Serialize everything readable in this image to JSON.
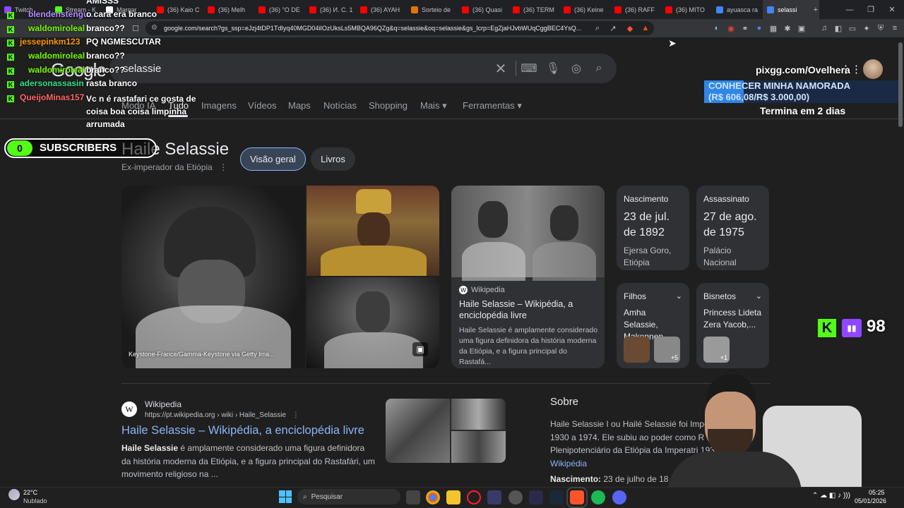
{
  "tabs": [
    {
      "label": "Twitch",
      "color": "#9146ff"
    },
    {
      "label": "Stream - K",
      "color": "#53fc18"
    },
    {
      "label": "Margar",
      "color": "#ffffff"
    },
    {
      "label": "(36) Kaio C",
      "color": "#ff0000"
    },
    {
      "label": "(36) Melh",
      "color": "#ff0000"
    },
    {
      "label": "(36) \"O DE",
      "color": "#ff0000"
    },
    {
      "label": "(36) И. С. 1",
      "color": "#ff0000"
    },
    {
      "label": "(36) AYAH",
      "color": "#ff0000"
    },
    {
      "label": "Sorteio de",
      "color": "#e8710a"
    },
    {
      "label": "(36) Quasi",
      "color": "#ff0000"
    },
    {
      "label": "(36) TERM",
      "color": "#ff0000"
    },
    {
      "label": "(36) Keine",
      "color": "#ff0000"
    },
    {
      "label": "(36) RAFF",
      "color": "#ff0000"
    },
    {
      "label": "(36) MITO",
      "color": "#ff0000"
    },
    {
      "label": "ayuasca ra",
      "color": "#4285f4"
    },
    {
      "label": "selassi",
      "color": "#4285f4",
      "active": true
    }
  ],
  "address": {
    "url": "google.com/search?gs_ssp=eJzj4tDP1TdIyq40MGD04iIOzUksLs5MBQA96QZg&q=selassie&oq=selassie&gs_lcrp=EgZjaHJvbWUqCggBEC4YsQ..."
  },
  "search": {
    "logo": "Google",
    "query": "selassie",
    "tabs": [
      "Modo IA",
      "Tudo",
      "Imagens",
      "Vídeos",
      "Maps",
      "Notícias",
      "Shopping",
      "Mais",
      "Ferramentas"
    ]
  },
  "knowledge_panel": {
    "title": "Haile Selassie",
    "subtitle": "Ex-imperador da Etiópia",
    "chips": [
      "Visão geral",
      "Livros"
    ],
    "image_credit": "Keystone-France/Gamma-Keystone via Getty Ima...",
    "wiki_card": {
      "source": "Wikipedia",
      "title": "Haile Selassie – Wikipédia, a enciclopédia livre",
      "snippet": "Haile Selassie é amplamente considerado uma figura definidora da história moderna da Etiópia, e a figura principal do Rastafá..."
    },
    "facts": [
      {
        "label": "Nascimento",
        "value": "23 de jul. de 1892",
        "detail": "Ejersa Goro, Etiópia"
      },
      {
        "label": "Assassinato",
        "value": "27 de ago. de 1975",
        "detail": "Palácio Nacional"
      }
    ],
    "filhos": {
      "label": "Filhos",
      "names": "Amha Selassie, Makonnen,...",
      "more": "+5"
    },
    "bisnetos": {
      "label": "Bisnetos",
      "names": "Princess Lideta Zera Yacob,...",
      "more": "+1"
    }
  },
  "result": {
    "site": "Wikipedia",
    "breadcrumb": "https://pt.wikipedia.org › wiki › Haile_Selassie",
    "title": "Haile Selassie – Wikipédia, a enciclopédia livre",
    "snippet_bold": "Haile Selassie",
    "snippet": " é amplamente considerado uma figura definidora da história moderna da Etiópia, e a figura principal do Rastafári, um movimento religioso na ..."
  },
  "about": {
    "heading": "Sobre",
    "text": "Haile Selassie I ou Hailé Selassié foi Imper de 1930 a 1974. Ele subiu ao poder como R Plenipotenciário da Etiópia da Imperatri 1930.",
    "link": "Wikipédia",
    "birth_label": "Nascimento:",
    "birth_value": "23 de julho de 18"
  },
  "overlay": {
    "chat": [
      {
        "user": "",
        "msg": "AMISSS",
        "ucolor": "#ffffff"
      },
      {
        "user": "blendenstengu...",
        "msg": "o cara era branco",
        "ucolor": "#b38cff"
      },
      {
        "user": "waldomiroleal",
        "msg": "branco??",
        "ucolor": "#7cfc00"
      },
      {
        "user": "jessepinkm123",
        "msg": "PQ NGMESCUTAR",
        "ucolor": "#ff9900"
      },
      {
        "user": "waldomiroleal",
        "msg": "branco??",
        "ucolor": "#7cfc00"
      },
      {
        "user": "waldomiroleal",
        "msg": "branco??",
        "ucolor": "#7cfc00"
      },
      {
        "user": "adersonassasin",
        "msg": "rasta branco",
        "ucolor": "#33dd88"
      },
      {
        "user": "QueijoMinas157",
        "msg": "Vc n é rastafari ce gosta de coisa boa coisa limpinha arrumada",
        "ucolor": "#ff6666"
      }
    ],
    "subscribers_count": "0",
    "subscribers_label": "SUBSCRIBERS",
    "pix_url": "pixgg.com/Ovelhera",
    "goal_title": "CONHECER MINHA NAMORADA",
    "goal_progress": "(R$ 606,08/R$ 3.000,00)",
    "goal_fraction": 0.202,
    "goal_deadline": "Termina em 2 dias",
    "viewer_count": "98"
  },
  "taskbar": {
    "weather_temp": "22°C",
    "weather_desc": "Nublado",
    "search_placeholder": "Pesquisar",
    "time": "05:25",
    "date": "05/01/2026"
  }
}
